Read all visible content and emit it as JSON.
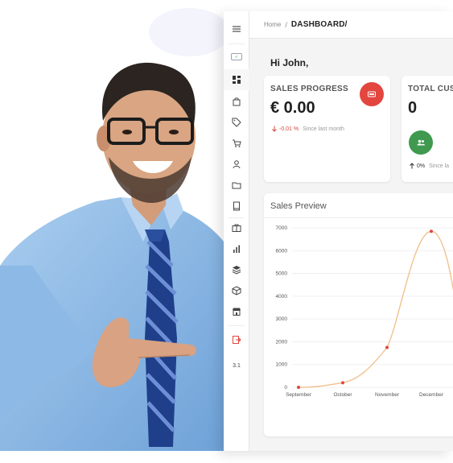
{
  "breadcrumb": {
    "home": "Home",
    "separator": "/",
    "current": "DASHBOARD/"
  },
  "greeting": "Hi John,",
  "sidebar": {
    "version": "3.1",
    "items": [
      {
        "icon": "menu-icon"
      },
      {
        "icon": "logo-icon"
      },
      {
        "icon": "dashboard-icon"
      },
      {
        "icon": "shopping-bag-icon"
      },
      {
        "icon": "tag-icon"
      },
      {
        "icon": "cart-icon"
      },
      {
        "icon": "user-icon"
      },
      {
        "icon": "folder-icon"
      },
      {
        "icon": "book-icon"
      },
      {
        "icon": "briefcase-icon"
      },
      {
        "icon": "bar-chart-icon"
      },
      {
        "icon": "layers-icon"
      },
      {
        "icon": "box-icon"
      },
      {
        "icon": "store-icon"
      },
      {
        "icon": "logout-icon"
      }
    ]
  },
  "cards": {
    "sales": {
      "title": "SALES PROGRESS",
      "value": "€ 0.00",
      "change": "-0.01 %",
      "since": "Since last month",
      "icon": "wallet-icon",
      "icon_color": "#e2463f",
      "change_color": "#d9453c"
    },
    "customers": {
      "title": "TOTAL CUS",
      "value": "0",
      "change": "0%",
      "since": "Since la",
      "icon": "users-icon",
      "icon_color": "#3f9a4f"
    }
  },
  "chart_data": {
    "type": "line",
    "title": "Sales Preview",
    "categories": [
      "September",
      "October",
      "November",
      "December"
    ],
    "series": [
      {
        "values": [
          0,
          200,
          1750,
          6850
        ]
      }
    ],
    "y_ticks": [
      "0",
      "1000",
      "2000",
      "3000",
      "4000",
      "5000",
      "6000",
      "7000"
    ],
    "ylim": [
      0,
      7000
    ],
    "line_color": "#f0c28f",
    "point_color": "#e2463f",
    "grid": "horizontal"
  }
}
